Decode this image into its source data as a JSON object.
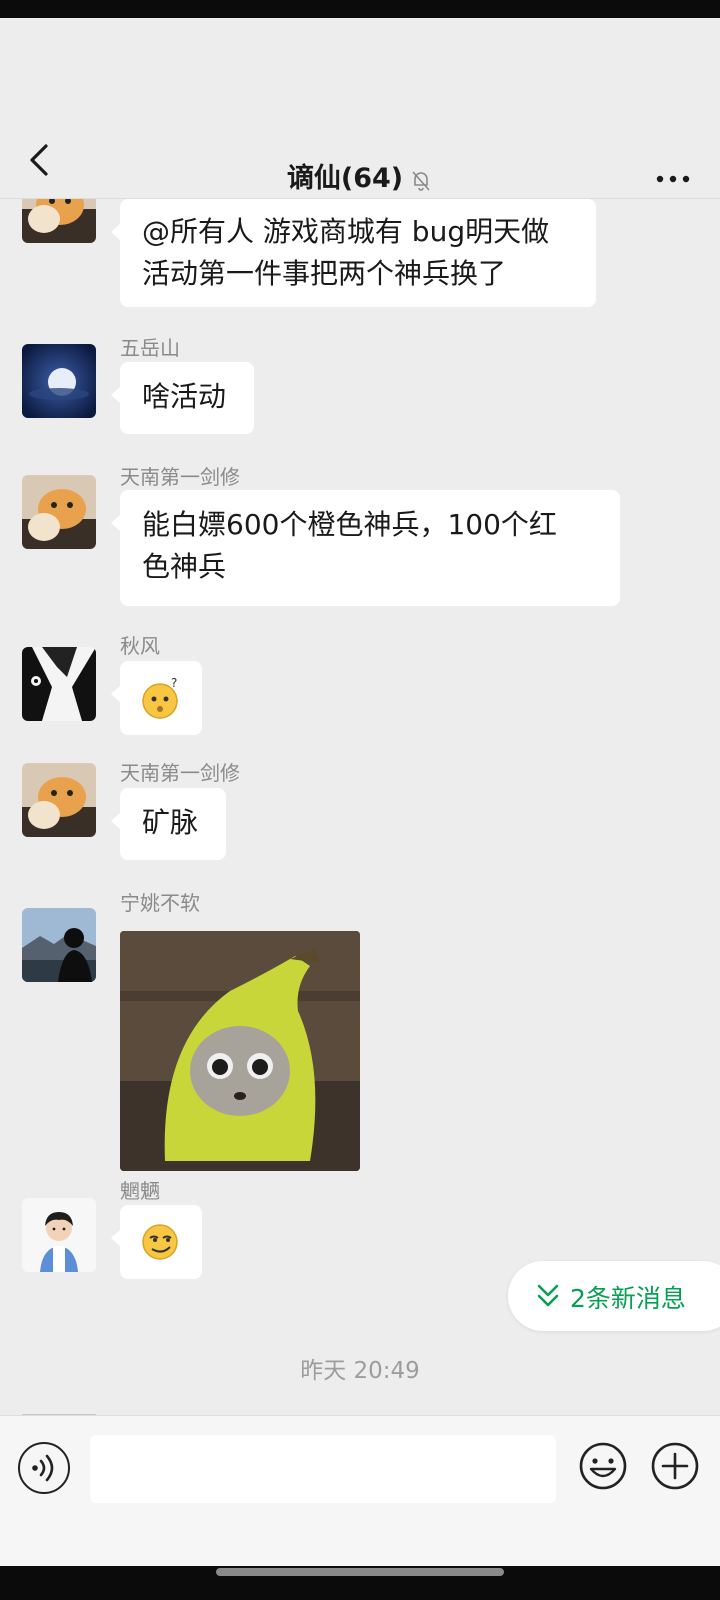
{
  "header": {
    "title": "谪仙(64)",
    "muted": true,
    "back_icon": "chevron-left-icon",
    "more_icon": "ellipsis-icon",
    "bell_icon": "bell-off-icon"
  },
  "messages": [
    {
      "sender": "",
      "avatar": "cat-avatar",
      "type": "text",
      "text_line1": "@所有人 游戏商城有 bug明天做",
      "text_line2": "活动第一件事把两个神兵换了"
    },
    {
      "sender": "五岳山",
      "avatar": "moon-avatar",
      "type": "text",
      "text": "啥活动"
    },
    {
      "sender": "天南第一剑修",
      "avatar": "cat-avatar",
      "type": "text",
      "text_line1": "能白嫖600个橙色神兵，100个红",
      "text_line2": "色神兵"
    },
    {
      "sender": "秋风",
      "avatar": "anime-avatar",
      "type": "emoji",
      "emoji": "confused-face-emoji"
    },
    {
      "sender": "天南第一剑修",
      "avatar": "cat-avatar",
      "type": "text",
      "text": "矿脉"
    },
    {
      "sender": "宁姚不软",
      "avatar": "silhouette-avatar",
      "type": "image",
      "image": "banana-cat-photo"
    },
    {
      "sender": "魍魉",
      "avatar": "boy-avatar",
      "type": "emoji",
      "emoji": "smirk-face-emoji"
    }
  ],
  "new_messages": {
    "label": "2条新消息",
    "color": "#07a053"
  },
  "timestamp": "昨天 20:49",
  "input": {
    "value": "",
    "placeholder": ""
  },
  "colors": {
    "background": "#ededed",
    "bubble": "#ffffff",
    "accent": "#07a053"
  }
}
